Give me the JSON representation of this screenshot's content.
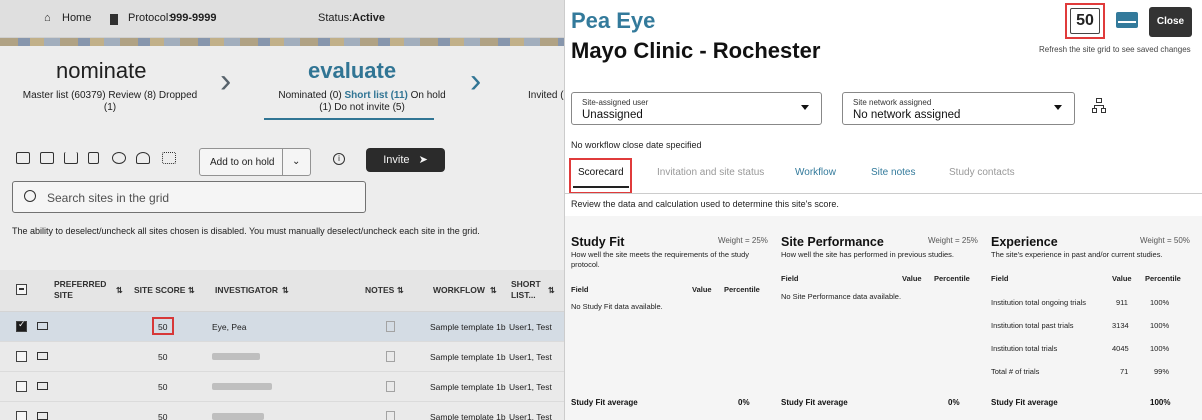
{
  "topbar": {
    "home": "Home",
    "protocol_label": "Protocol:",
    "protocol_value": "999-9999",
    "status_label": "Status:",
    "status_value": "Active"
  },
  "stages": {
    "nominate": {
      "title": "nominate",
      "line1": "Master list (60379)  Review (8)  Dropped",
      "line2": "(1)"
    },
    "evaluate": {
      "title": "evaluate",
      "line1a": "Nominated (0) ",
      "line1b": "Short list (11)",
      "line1c": " On hold",
      "line2": "(1)  Do not invite (5)"
    },
    "next": {
      "line1": "Invited ("
    }
  },
  "toolbar": {
    "hold_label": "Add to on hold",
    "invite_label": "Invite"
  },
  "search": {
    "placeholder": "Search sites in the grid"
  },
  "notice": "The ability to deselect/uncheck all sites chosen is disabled. You must manually deselect/uncheck each site in the grid.",
  "grid": {
    "headers": {
      "preferred": "PREFERRED",
      "site": "SITE",
      "score": "SITE SCORE",
      "investigator": "INVESTIGATOR",
      "notes": "NOTES",
      "workflow": "WORKFLOW",
      "short1": "SHORT",
      "short2": "LIST..."
    },
    "rows": [
      {
        "score": "50",
        "investigator": "Eye, Pea",
        "workflow": "Sample template 1b",
        "user": "User1, Test"
      },
      {
        "score": "50",
        "investigator": "",
        "workflow": "Sample template 1b",
        "user": "User1, Test"
      },
      {
        "score": "50",
        "investigator": "",
        "workflow": "Sample template 1b",
        "user": "User1, Test"
      },
      {
        "score": "50",
        "investigator": "",
        "workflow": "Sample template 1b",
        "user": "User1, Test"
      }
    ]
  },
  "panel": {
    "name": "Pea Eye",
    "site": "Mayo Clinic - Rochester",
    "score": "50",
    "close": "Close",
    "refresh": "Refresh the site grid to see saved changes",
    "user_label": "Site-assigned user",
    "user_value": "Unassigned",
    "network_label": "Site network assigned",
    "network_value": "No network assigned",
    "close_date": "No workflow close date specified",
    "tabs": [
      "Scorecard",
      "Invitation and site status",
      "Workflow",
      "Site notes",
      "Study contacts"
    ],
    "review": "Review the data and calculation used to determine this site's score.",
    "study_fit": {
      "title": "Study Fit",
      "weight": "Weight = 25%",
      "desc1": "How well the site meets the requirements of the study",
      "desc2": "protocol.",
      "field": "Field",
      "value": "Value",
      "percentile": "Percentile",
      "empty": "No Study Fit data available.",
      "avg_label": "Study Fit average",
      "avg_value": "0%"
    },
    "site_perf": {
      "title": "Site Performance",
      "weight": "Weight = 25%",
      "desc1": "How well the site has performed in previous studies.",
      "field": "Field",
      "value": "Value",
      "percentile": "Percentile",
      "empty": "No Site Performance data available.",
      "avg_label": "Study Fit average",
      "avg_value": "0%"
    },
    "experience": {
      "title": "Experience",
      "weight": "Weight = 50%",
      "desc1": "The site's experience in past and/or current studies.",
      "field": "Field",
      "value": "Value",
      "percentile": "Percentile",
      "rows": [
        {
          "field": "Institution total ongoing trials",
          "value": "911",
          "pct": "100%"
        },
        {
          "field": "Institution total past trials",
          "value": "3134",
          "pct": "100%"
        },
        {
          "field": "Institution total trials",
          "value": "4045",
          "pct": "100%"
        },
        {
          "field": "Total # of trials",
          "value": "71",
          "pct": "99%"
        }
      ],
      "avg_label": "Study Fit average",
      "avg_value": "100%"
    }
  },
  "colors": {
    "accent": "#337a9b",
    "highlight": "#e03b3b",
    "dark_button": "#2d2d2d"
  }
}
